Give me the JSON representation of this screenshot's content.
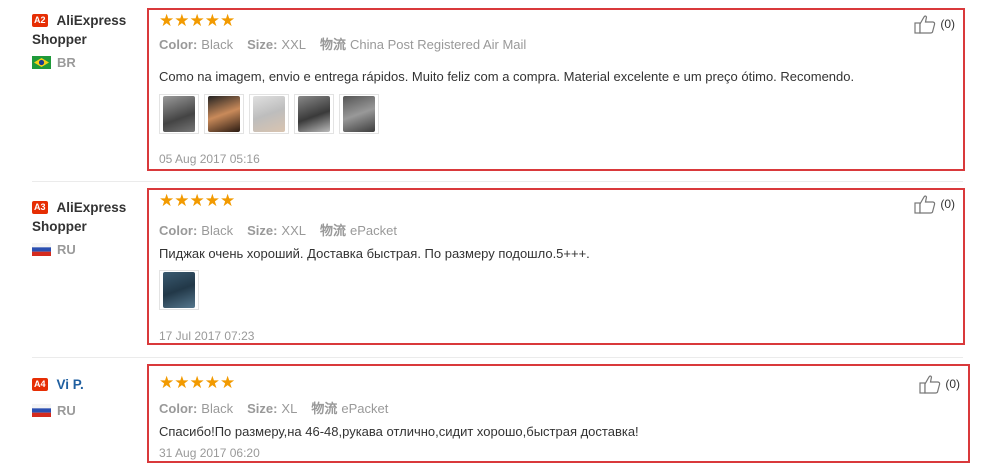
{
  "reviews": [
    {
      "badge": "A2",
      "user": "AliExpress Shopper",
      "country": "BR",
      "stars": "★★★★★",
      "color_label": "Color:",
      "color": "Black",
      "size_label": "Size:",
      "size": "XXL",
      "logistics_label": "物流",
      "logistics": "China Post Registered Air Mail",
      "text": "Como na imagem, envio e entrega rápidos. Muito feliz com a compra. Material excelente e um preço ótimo. Recomendo.",
      "photos": [
        "photo-1",
        "photo-2",
        "photo-3",
        "photo-4",
        "photo-5"
      ],
      "date": "05 Aug 2017 05:16",
      "likes": "(0)"
    },
    {
      "badge": "A3",
      "user": "AliExpress Shopper",
      "country": "RU",
      "stars": "★★★★★",
      "color_label": "Color:",
      "color": "Black",
      "size_label": "Size:",
      "size": "XXL",
      "logistics_label": "物流",
      "logistics": "ePacket",
      "text": "Пиджак очень хороший. Доставка быстрая. По размеру подошло.5+++.",
      "photos": [
        "photo-1"
      ],
      "date": "17 Jul 2017 07:23",
      "likes": "(0)"
    },
    {
      "badge": "A4",
      "user": "Vi P.",
      "country": "RU",
      "stars": "★★★★★",
      "color_label": "Color:",
      "color": "Black",
      "size_label": "Size:",
      "size": "XL",
      "logistics_label": "物流",
      "logistics": "ePacket",
      "text": "Спасибо!По размеру,на 46-48,рукава отлично,сидит хорошо,быстрая доставка!",
      "date": "31 Aug 2017 06:20",
      "likes": "(0)"
    }
  ],
  "colors": {
    "highlight_border": "#d9393b",
    "star": "#f29a00",
    "badge": "#e62e04",
    "link": "#1f5fa0"
  }
}
